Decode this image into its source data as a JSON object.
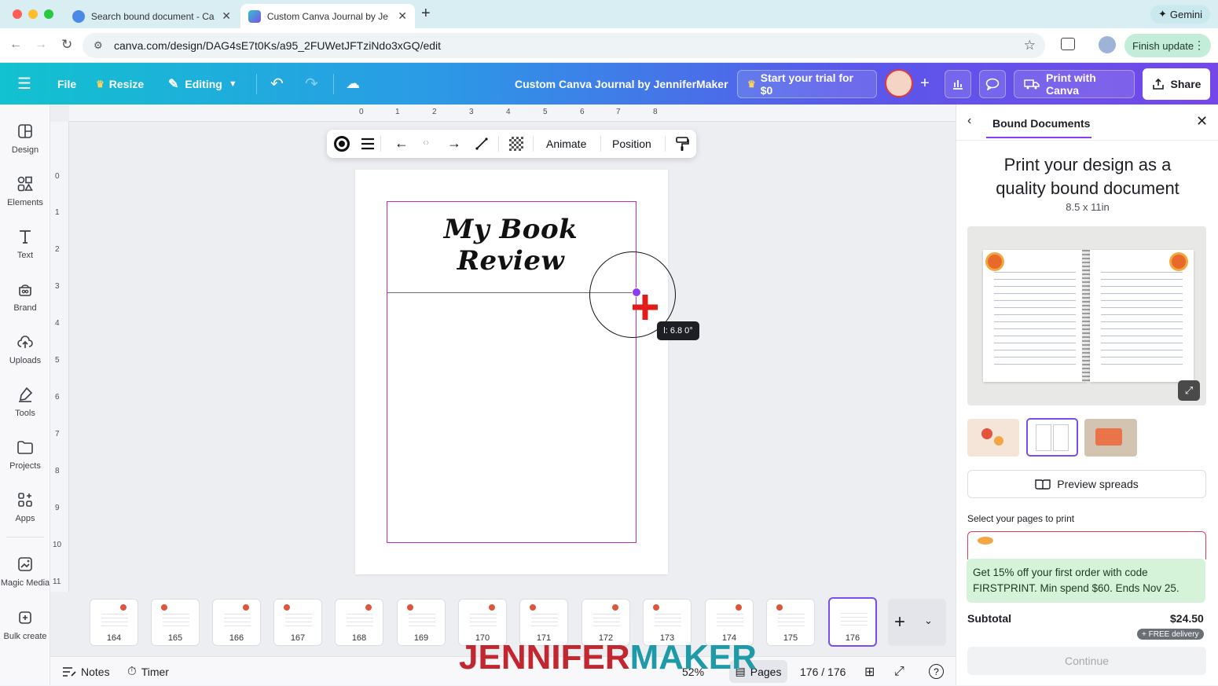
{
  "browser": {
    "tabs": [
      {
        "title": "Search bound document - Ca",
        "active": false
      },
      {
        "title": "Custom Canva Journal by Je",
        "active": true
      }
    ],
    "new_tab": "+",
    "gemini": "Gemini",
    "url": "canva.com/design/DAG4sE7t0Ks/a95_2FUWetJFTziNdo3xGQ/edit",
    "finish_update": "Finish update"
  },
  "header": {
    "file": "File",
    "resize": "Resize",
    "editing": "Editing",
    "doc_title": "Custom Canva Journal by JenniferMaker",
    "trial": "Start your trial for $0",
    "print": "Print with Canva",
    "share": "Share",
    "colors": {
      "gradient_start": "#12c2cf",
      "gradient_end": "#7448e8"
    }
  },
  "sidebar": {
    "items": [
      {
        "label": "Design",
        "icon": "layout-icon"
      },
      {
        "label": "Elements",
        "icon": "shapes-icon"
      },
      {
        "label": "Text",
        "icon": "text-icon"
      },
      {
        "label": "Brand",
        "icon": "brand-icon"
      },
      {
        "label": "Uploads",
        "icon": "cloud-upload-icon"
      },
      {
        "label": "Tools",
        "icon": "pen-icon"
      },
      {
        "label": "Projects",
        "icon": "folder-icon"
      },
      {
        "label": "Apps",
        "icon": "apps-icon"
      },
      {
        "label": "Magic Media",
        "icon": "magic-media-icon"
      },
      {
        "label": "Bulk create",
        "icon": "bulk-create-icon"
      }
    ]
  },
  "rulers": {
    "top": [
      "0",
      "1",
      "2",
      "3",
      "4",
      "5",
      "6",
      "7",
      "8"
    ],
    "left": [
      "0",
      "1",
      "2",
      "3",
      "4",
      "5",
      "6",
      "7",
      "8",
      "9",
      "10",
      "11"
    ]
  },
  "toolbar": {
    "animate": "Animate",
    "position": "Position"
  },
  "canvas": {
    "page_title": "My Book Review",
    "angle_readout": "l: 6.8 0°"
  },
  "thumbnails": [
    "164",
    "165",
    "166",
    "167",
    "168",
    "169",
    "170",
    "171",
    "172",
    "173",
    "174",
    "175",
    "176"
  ],
  "bottom": {
    "notes": "Notes",
    "timer": "Timer",
    "zoom": "52%",
    "pages": "Pages",
    "page_count": "176 / 176"
  },
  "panel": {
    "tab": "Bound Documents",
    "heading_line1": "Print your design as a",
    "heading_line2": "quality bound document",
    "size": "8.5 x 11in",
    "preview_spreads": "Preview spreads",
    "select_pages": "Select your pages to print",
    "promo": "Get 15% off your first order with code FIRSTPRINT. Min spend $60. Ends Nov 25.",
    "subtotal_label": "Subtotal",
    "subtotal_value": "$24.50",
    "free_delivery": "+ FREE delivery",
    "continue": "Continue"
  },
  "watermark": {
    "part1": "JENNIFER",
    "part2": "MAKER",
    "color1": "#c2262e",
    "color2": "#1f9aa8"
  }
}
